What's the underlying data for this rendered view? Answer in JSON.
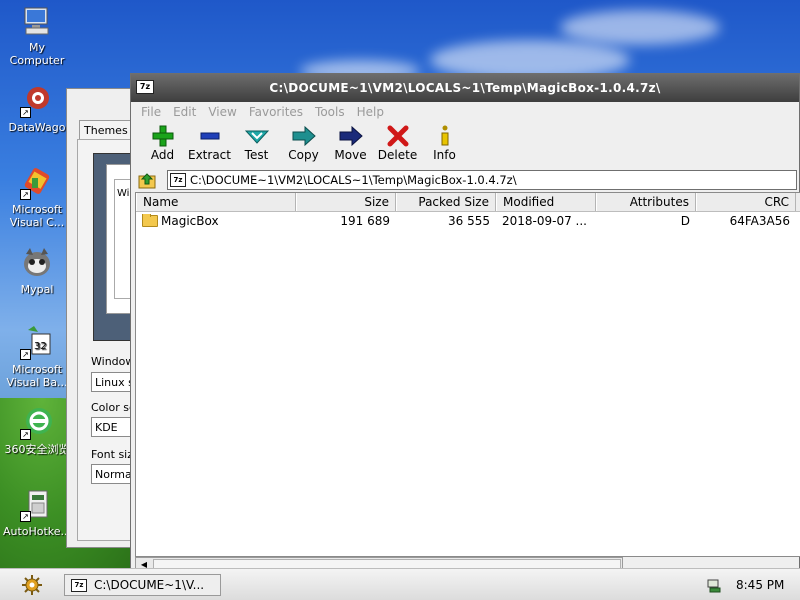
{
  "desktop": {
    "icons": [
      {
        "label_1": "My",
        "label_2": "Computer",
        "icon": "computer-icon"
      },
      {
        "label_1": "DataWago",
        "label_2": "",
        "icon": "datawago-icon"
      },
      {
        "label_1": "Microsoft",
        "label_2": "Visual C...",
        "icon": "visual-c-icon"
      },
      {
        "label_1": "Mypal",
        "label_2": "",
        "icon": "mypal-icon"
      },
      {
        "label_1": "Microsoft",
        "label_2": "Visual Ba...",
        "icon": "visual-basic-icon"
      },
      {
        "label_1": "360安全浏览",
        "label_2": "",
        "icon": "360-browser-icon"
      },
      {
        "label_1": "AutoHotke...",
        "label_2": "",
        "icon": "autohotkey-icon"
      }
    ]
  },
  "bg_window": {
    "tab": "Themes",
    "preview_text": "Wi",
    "window_label": "Window",
    "window_value": "Linux st",
    "color_label": "Color sc",
    "color_value": "KDE",
    "font_label": "Font size",
    "font_value": "Normal"
  },
  "window": {
    "app_icon_text": "7z",
    "title": "C:\\DOCUME~1\\VM2\\LOCALS~1\\Temp\\MagicBox-1.0.4.7z\\",
    "menu": [
      "File",
      "Edit",
      "View",
      "Favorites",
      "Tools",
      "Help"
    ],
    "toolbar": {
      "add": "Add",
      "extract": "Extract",
      "test": "Test",
      "copy": "Copy",
      "move": "Move",
      "delete": "Delete",
      "info": "Info"
    },
    "address": "C:\\DOCUME~1\\VM2\\LOCALS~1\\Temp\\MagicBox-1.0.4.7z\\",
    "columns": {
      "name": "Name",
      "size": "Size",
      "packed": "Packed Size",
      "modified": "Modified",
      "attributes": "Attributes",
      "crc": "CRC"
    },
    "rows": [
      {
        "name": "MagicBox",
        "size": "191 689",
        "packed": "36 555",
        "modified": "2018-09-07 ...",
        "attributes": "D",
        "crc": "64FA3A56"
      }
    ]
  },
  "taskbar": {
    "task_icon_text": "7z",
    "task_label": "C:\\DOCUME~1\\V...",
    "clock": "8:45 PM"
  },
  "colors": {
    "add": "#1aa31a",
    "extract": "#1f3fb8",
    "test": "#1fa7a7",
    "copy": "#1f8f8f",
    "move": "#1a2a7a",
    "delete": "#d01818",
    "info": "#b08f00"
  }
}
